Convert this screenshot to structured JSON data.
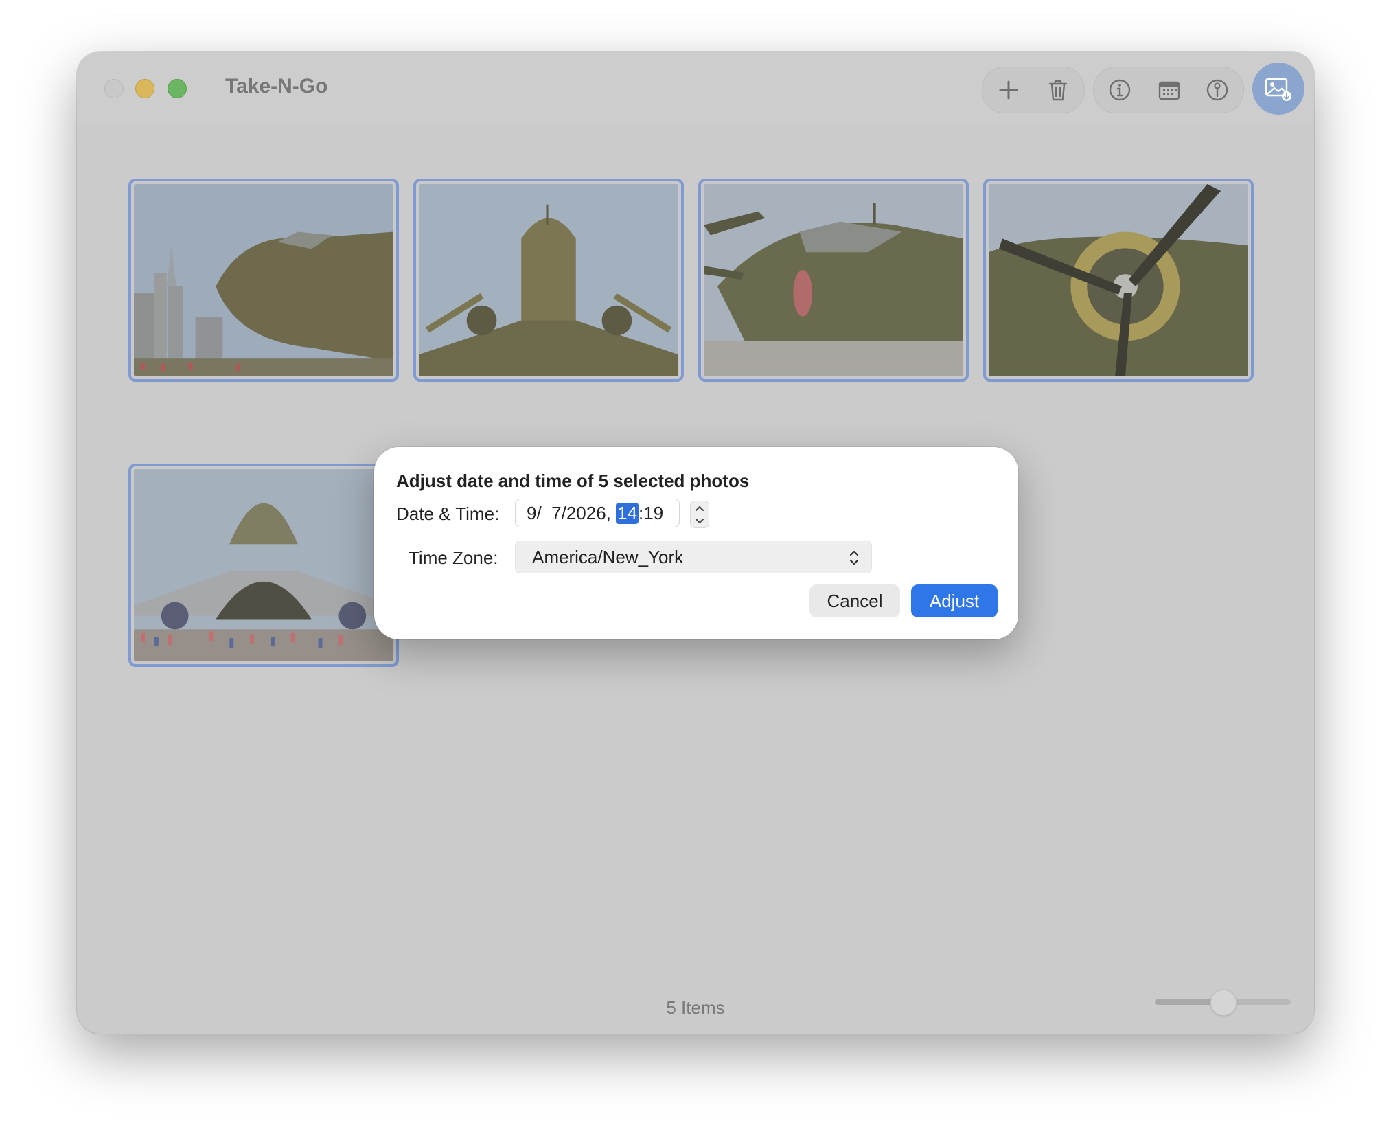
{
  "window": {
    "title": "Take-N-Go"
  },
  "toolbar": {
    "buttons": [
      {
        "name": "add",
        "icon": "plus-icon"
      },
      {
        "name": "delete",
        "icon": "trash-icon"
      },
      {
        "name": "info",
        "icon": "info-icon"
      },
      {
        "name": "calendar",
        "icon": "calendar-icon"
      },
      {
        "name": "location",
        "icon": "pin-icon"
      },
      {
        "name": "import",
        "icon": "photo-import-icon"
      }
    ]
  },
  "photos": [
    {
      "subject": "c47-nose",
      "selected": true
    },
    {
      "subject": "dc3-tail",
      "selected": true
    },
    {
      "subject": "b25-nose-art",
      "selected": true
    },
    {
      "subject": "b25-engine",
      "selected": true
    },
    {
      "subject": "c5-cargo-bay",
      "selected": true
    }
  ],
  "status": {
    "items_label": "5 Items",
    "zoom_level": 0.5
  },
  "dialog": {
    "title": "Adjust date and time of 5 selected photos",
    "date_time_label": "Date & Time:",
    "date_part": "9/  7/2026, ",
    "hour_part": "14",
    "minute_part": ":19",
    "time_zone_label": "Time Zone:",
    "time_zone_value": "America/New_York",
    "cancel_label": "Cancel",
    "adjust_label": "Adjust"
  },
  "colors": {
    "accent": "#2f76e8",
    "selection_border": "#7f9bd1"
  }
}
